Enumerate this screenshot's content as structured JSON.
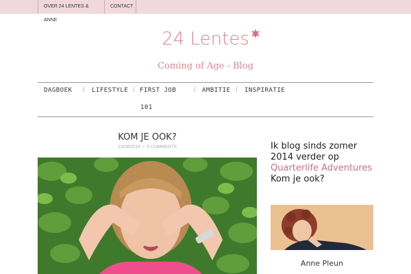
{
  "topnav": {
    "items": [
      {
        "label": "OVER 24 LENTES & ANNE"
      },
      {
        "label": "CONTACT"
      }
    ]
  },
  "header": {
    "site_title": "24 Lentes",
    "tagline": "Coming of Age - Blog"
  },
  "mainnav": {
    "items": [
      {
        "label": "DAGBOEK"
      },
      {
        "label": "LIFESTYLE"
      },
      {
        "label": "FIRST JOB"
      },
      {
        "label": "101"
      },
      {
        "label": "AMBITIE"
      },
      {
        "label": "INSPIRATIE"
      }
    ],
    "separator": "/"
  },
  "post": {
    "title": "KOM JE OOK?",
    "date": "23/08/2014",
    "meta_sep": "/",
    "comments": "5 COMMENTS"
  },
  "sidebar": {
    "line1": "Ik blog sinds zomer 2014 verder op",
    "link": "Quarterlife Adventures",
    "line2": "Kom je ook?",
    "caption": "Anne Pleun"
  },
  "colors": {
    "topbar": "#f1d8dc",
    "accent": "#d9858f",
    "link": "#c96f86"
  }
}
